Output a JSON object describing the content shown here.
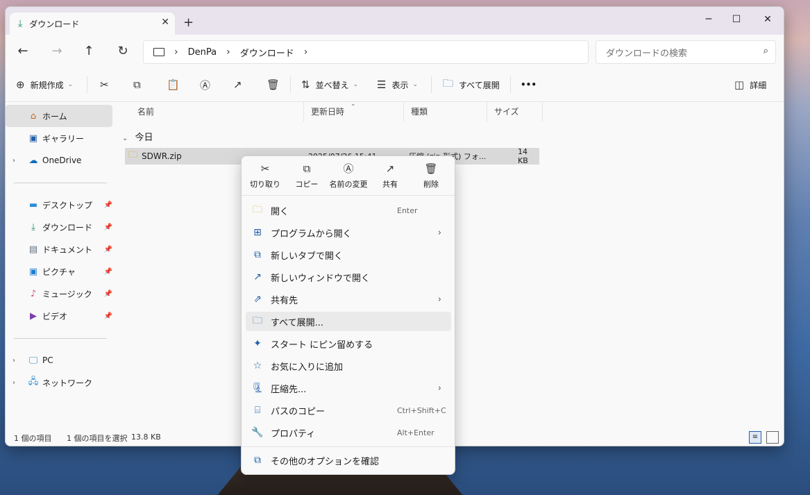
{
  "window": {
    "tab_title": "ダウンロード",
    "new_tab": "+",
    "minimize": "─",
    "maximize": "☐",
    "close": "✕"
  },
  "nav": {
    "back": "←",
    "forward": "→",
    "up": "↑",
    "refresh": "↻",
    "breadcrumbs": [
      "DenPa",
      "ダウンロード"
    ],
    "search_placeholder": "ダウンロードの検索"
  },
  "toolbar": {
    "new": "新規作成",
    "sort": "並べ替え",
    "view": "表示",
    "extract_all": "すべて展開",
    "more": "•••",
    "details": "詳細"
  },
  "sidebar": {
    "items": [
      {
        "label": "ホーム",
        "icon": "home-icon"
      },
      {
        "label": "ギャラリー",
        "icon": "gallery-icon"
      },
      {
        "label": "OneDrive",
        "icon": "cloud-icon"
      },
      {
        "label": "デスクトップ",
        "icon": "desktop-icon"
      },
      {
        "label": "ダウンロード",
        "icon": "download-icon"
      },
      {
        "label": "ドキュメント",
        "icon": "document-icon"
      },
      {
        "label": "ピクチャ",
        "icon": "pictures-icon"
      },
      {
        "label": "ミュージック",
        "icon": "music-icon"
      },
      {
        "label": "ビデオ",
        "icon": "video-icon"
      },
      {
        "label": "PC",
        "icon": "pc-icon"
      },
      {
        "label": "ネットワーク",
        "icon": "network-icon"
      }
    ]
  },
  "columns": [
    "名前",
    "更新日時",
    "種類",
    "サイズ"
  ],
  "group": "今日",
  "file": {
    "name": "SDWR.zip",
    "modified": "2025/07/26 15:41",
    "type": "圧縮 (zip 形式) フォ...",
    "size": "14 KB"
  },
  "status": {
    "count": "1 個の項目",
    "selected": "1 個の項目を選択",
    "size": "13.8 KB"
  },
  "context_menu": {
    "actions": [
      "切り取り",
      "コピー",
      "名前の変更",
      "共有",
      "削除"
    ],
    "items": [
      {
        "label": "開く",
        "shortcut": "Enter"
      },
      {
        "label": "プログラムから開く",
        "submenu": true
      },
      {
        "label": "新しいタブで開く"
      },
      {
        "label": "新しいウィンドウで開く"
      },
      {
        "label": "共有先",
        "submenu": true
      },
      {
        "label": "すべて展開..."
      },
      {
        "label": "スタート にピン留めする"
      },
      {
        "label": "お気に入りに追加"
      },
      {
        "label": "圧縮先...",
        "submenu": true
      },
      {
        "label": "パスのコピー",
        "shortcut": "Ctrl+Shift+C"
      },
      {
        "label": "プロパティ",
        "shortcut": "Alt+Enter"
      },
      {
        "label": "その他のオプションを確認"
      }
    ]
  },
  "colors": {
    "accent": "#1f5fa8",
    "selection": "#d9d9d9"
  }
}
